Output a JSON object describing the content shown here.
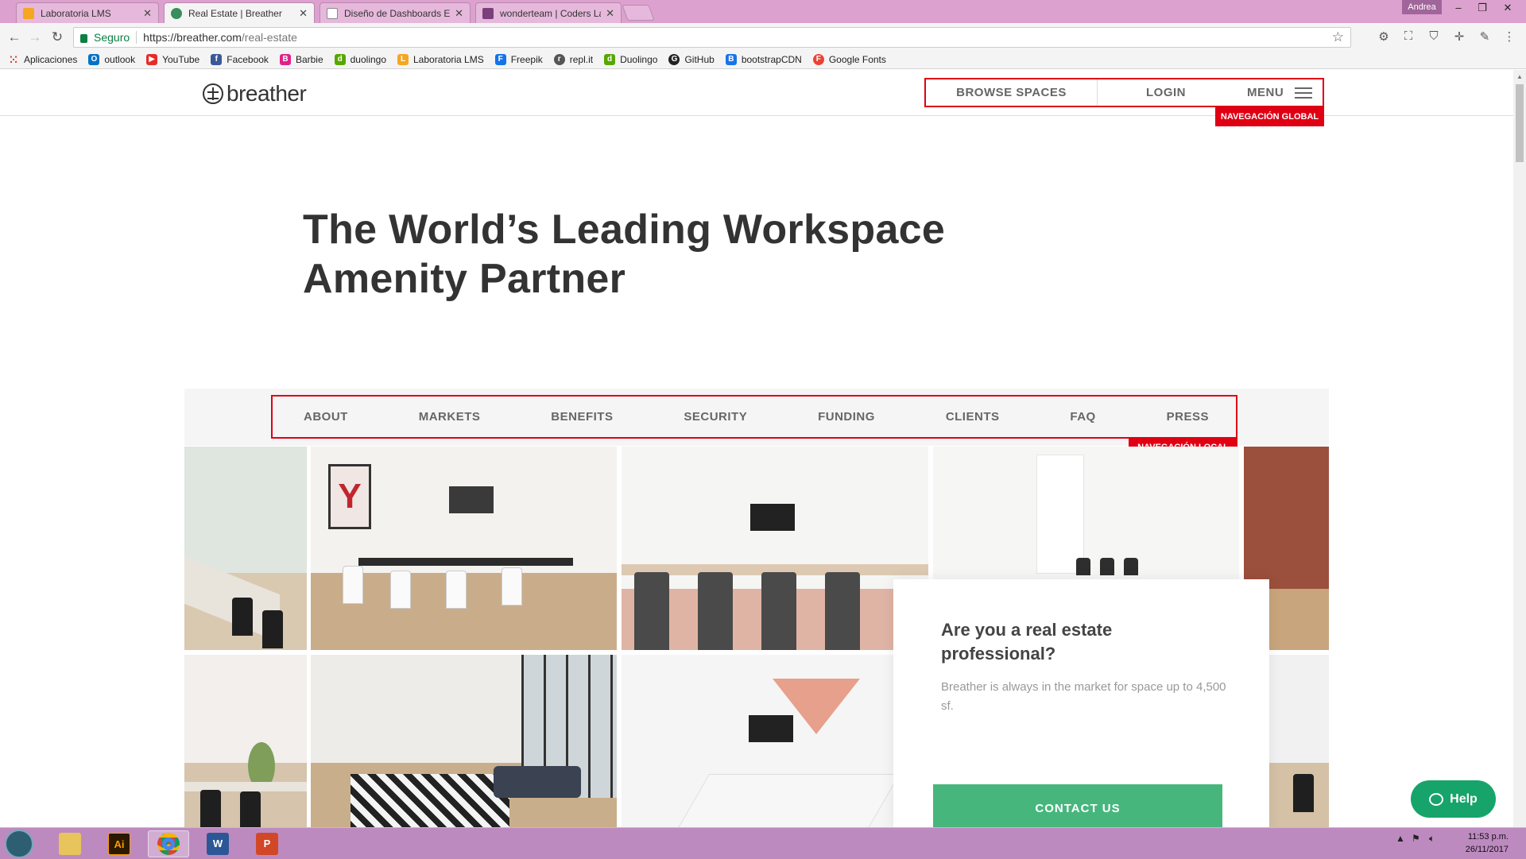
{
  "browser": {
    "tabs": [
      {
        "label": "Laboratoria LMS",
        "favicon_color": "#f5a623"
      },
      {
        "label": "Real Estate | Breather",
        "favicon_color": "#3a8d5c",
        "active": true
      },
      {
        "label": "Diseño de Dashboards E",
        "favicon_color": "#888888"
      },
      {
        "label": "wonderteam | Coders La",
        "favicon_color": "#7b3f7b"
      }
    ],
    "user": "Andrea",
    "security_label": "Seguro",
    "url_host": "https://breather.com",
    "url_path": "/real-estate",
    "bookmarks": [
      {
        "label": "Aplicaciones",
        "icon": "apps-grid-icon",
        "color": "#d44"
      },
      {
        "label": "outlook",
        "icon": "outlook-icon",
        "color": "#0072c6"
      },
      {
        "label": "YouTube",
        "icon": "youtube-icon",
        "color": "#e52d27"
      },
      {
        "label": "Facebook",
        "icon": "facebook-icon",
        "color": "#3b5998"
      },
      {
        "label": "Barbie",
        "icon": "barbie-icon",
        "color": "#e0218a"
      },
      {
        "label": "duolingo",
        "icon": "duolingo-icon",
        "color": "#58a700"
      },
      {
        "label": "Laboratoria LMS",
        "icon": "laboratoria-icon",
        "color": "#f5a623"
      },
      {
        "label": "Freepik",
        "icon": "freepik-icon",
        "color": "#1273eb"
      },
      {
        "label": "repl.it",
        "icon": "replit-icon",
        "color": "#555555"
      },
      {
        "label": "Duolingo",
        "icon": "duolingo-icon",
        "color": "#58a700"
      },
      {
        "label": "GitHub",
        "icon": "github-icon",
        "color": "#222222"
      },
      {
        "label": "bootstrapCDN",
        "icon": "bootstrap-icon",
        "color": "#1a73e8"
      },
      {
        "label": "Google Fonts",
        "icon": "google-fonts-icon",
        "color": "#ea4335"
      }
    ]
  },
  "site": {
    "logo_text": "breather",
    "global_nav": {
      "browse": "BROWSE SPACES",
      "login": "LOGIN",
      "menu": "MENU",
      "tag": "NAVEGACIÓN GLOBAL"
    },
    "hero_title": "The World’s Leading Workspace Amenity Partner",
    "local_nav": {
      "items": [
        "ABOUT",
        "MARKETS",
        "BENEFITS",
        "SECURITY",
        "FUNDING",
        "CLIENTS",
        "FAQ",
        "PRESS"
      ],
      "tag": "NAVEGACIÓN LOCAL"
    },
    "cta": {
      "title": "Are you a real estate professional?",
      "text": "Breather is always in the market for space up to 4,500 sf.",
      "button": "CONTACT US"
    },
    "help_label": "Help"
  },
  "taskbar": {
    "apps": [
      {
        "name": "file-explorer",
        "glyph": ""
      },
      {
        "name": "illustrator",
        "glyph": "Ai"
      },
      {
        "name": "chrome",
        "glyph": ""
      },
      {
        "name": "word",
        "glyph": "W"
      },
      {
        "name": "powerpoint",
        "glyph": "P"
      }
    ],
    "time": "11:53 p.m.",
    "date": "26/11/2017"
  },
  "colors": {
    "accent_red": "#e00014",
    "cta_green": "#47b67d",
    "help_green": "#16a46a",
    "taskbar": "#bd8ac0"
  }
}
